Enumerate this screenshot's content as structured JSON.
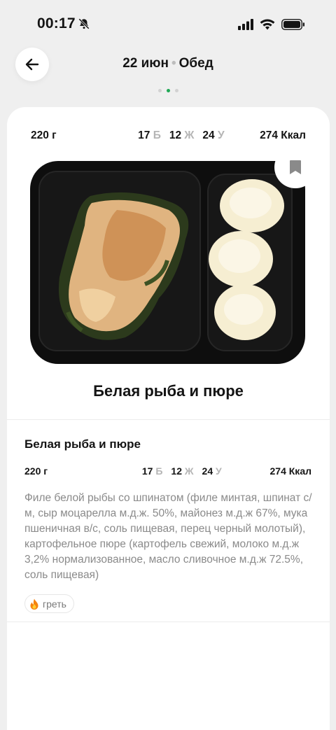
{
  "status_bar": {
    "time": "00:17",
    "icons": [
      "bell-off-icon",
      "cellular-icon",
      "wifi-icon",
      "battery-icon"
    ]
  },
  "header": {
    "date": "22 июн",
    "separator": "•",
    "meal": "Обед",
    "back_icon": "arrow-left-icon",
    "page_count": 3,
    "active_page": 2
  },
  "card": {
    "nutrition": {
      "weight": "220 г",
      "protein_value": "17",
      "protein_letter": "Б",
      "fat_value": "12",
      "fat_letter": "Ж",
      "carbs_value": "24",
      "carbs_letter": "У",
      "calories": "274 Ккал"
    },
    "bookmark_icon": "bookmark-icon",
    "title": "Белая рыба и пюре"
  },
  "details": {
    "title": "Белая рыба и пюре",
    "nutrition": {
      "weight": "220 г",
      "protein_value": "17",
      "protein_letter": "Б",
      "fat_value": "12",
      "fat_letter": "Ж",
      "carbs_value": "24",
      "carbs_letter": "У",
      "calories": "274 Ккал"
    },
    "description": "Филе белой рыбы со шпинатом (филе минтая, шпинат с/м, сыр моцарелла м.д.ж. 50%, майонез м.д.ж 67%, мука пшеничная в/с, соль пищевая, перец черный молотый), картофельное пюре (картофель свежий, молоко м.д.ж 3,2% нормализованное, масло сливочное м.д.ж 72.5%, соль пищевая)",
    "tag": {
      "icon": "fire-icon",
      "label": "греть"
    }
  },
  "colors": {
    "accent": "#1fa855",
    "background": "#efefef",
    "muted_text": "#8a8a8a",
    "macro_letter": "#b5b5b5"
  }
}
